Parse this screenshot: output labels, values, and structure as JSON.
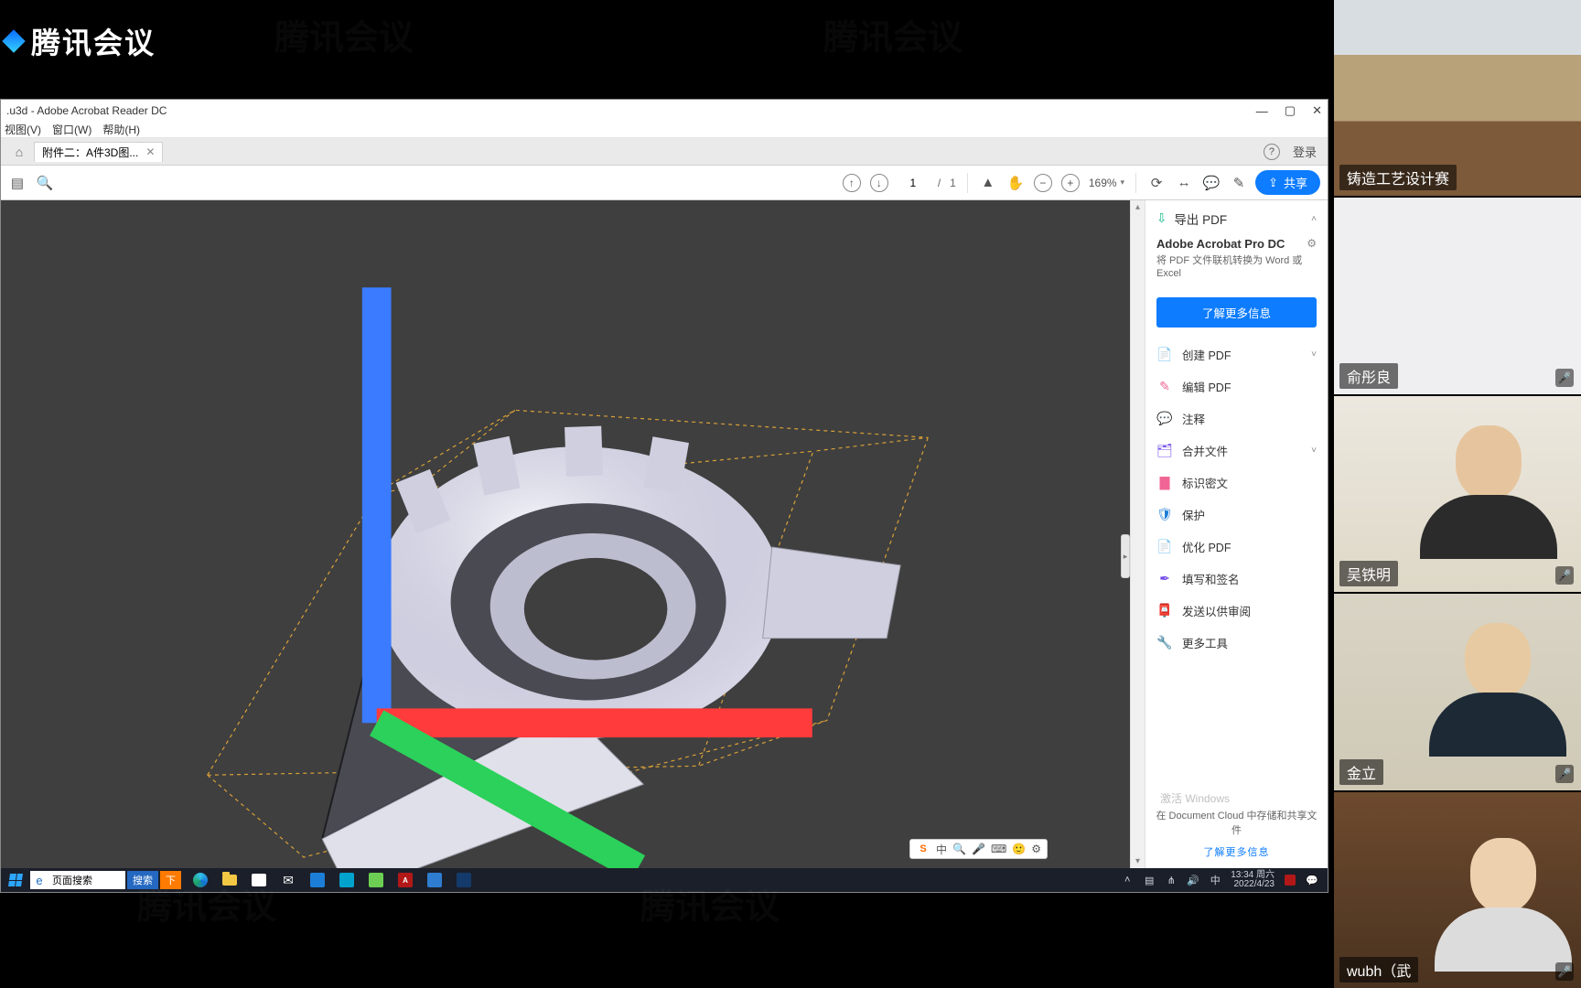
{
  "meeting": {
    "platform": "腾讯会议"
  },
  "participants": [
    {
      "name": "铸造工艺设计赛",
      "mic": "off"
    },
    {
      "name": "俞彤良",
      "mic": "off"
    },
    {
      "name": "吴铁明",
      "mic": "off"
    },
    {
      "name": "金立",
      "mic": "off"
    },
    {
      "name": "wubh（武",
      "mic": "on"
    }
  ],
  "shared_app": {
    "window_title": ".u3d - Adobe Acrobat Reader DC",
    "menu": [
      "视图(V)",
      "窗口(W)",
      "帮助(H)"
    ],
    "tab_label": "附件二：A件3D图...",
    "tabstrip_right": {
      "login": "登录"
    },
    "toolbar": {
      "page_current": "1",
      "page_total": "1",
      "zoom": "169%",
      "share_label": "共享"
    },
    "right_panel": {
      "header": "导出 PDF",
      "promo_title": "Adobe Acrobat Pro DC",
      "promo_desc": "将 PDF 文件联机转换为 Word 或 Excel",
      "cta": "了解更多信息",
      "items": [
        {
          "label": "创建 PDF",
          "color": "ic-red",
          "chev": true
        },
        {
          "label": "编辑 PDF",
          "color": "ic-pink",
          "chev": false
        },
        {
          "label": "注释",
          "color": "ic-yellow",
          "chev": false
        },
        {
          "label": "合并文件",
          "color": "ic-violet",
          "chev": true
        },
        {
          "label": "标识密文",
          "color": "ic-pink",
          "chev": false
        },
        {
          "label": "保护",
          "color": "ic-blue",
          "chev": false
        },
        {
          "label": "优化 PDF",
          "color": "ic-red",
          "chev": false
        },
        {
          "label": "填写和签名",
          "color": "ic-violet",
          "chev": false
        },
        {
          "label": "发送以供审阅",
          "color": "ic-yellow",
          "chev": false
        },
        {
          "label": "更多工具",
          "color": "ic-gray",
          "chev": false
        }
      ],
      "footer_note": "在 Document Cloud 中存储和共享文件",
      "footer_link": "了解更多信息",
      "watermark": "激活 Windows"
    },
    "ime": {
      "brand": "S",
      "lang": "中",
      "items": [
        "🔍",
        "🎤",
        "⌨",
        "🙂",
        "⚙"
      ]
    }
  },
  "taskbar": {
    "search_hint": "页面搜索",
    "search_btn": "搜索",
    "download_btn": "下",
    "time": "13:34 周六",
    "date": "2022/4/23"
  }
}
